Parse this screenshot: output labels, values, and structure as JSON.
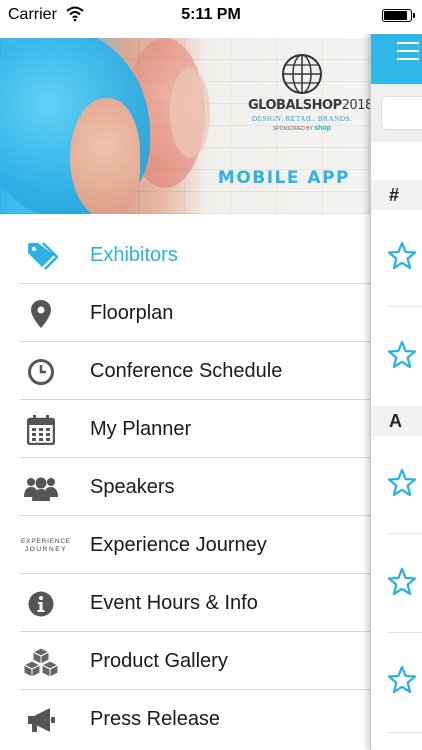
{
  "status_bar": {
    "carrier": "Carrier",
    "time": "5:11 PM"
  },
  "hero": {
    "brand_name": "GLOBALSHOP",
    "brand_year": "2018",
    "tagline": "DESIGN. RETAIL. BRANDS.",
    "sponsor_prefix": "SPONSORED BY",
    "sponsor_name": "shop",
    "subtitle": "MOBILE APP"
  },
  "menu": {
    "items": [
      {
        "label": "Exhibitors",
        "icon": "tags-icon",
        "active": true
      },
      {
        "label": "Floorplan",
        "icon": "map-marker-icon",
        "active": false
      },
      {
        "label": "Conference Schedule",
        "icon": "clock-icon",
        "active": false
      },
      {
        "label": "My Planner",
        "icon": "calendar-icon",
        "active": false
      },
      {
        "label": "Speakers",
        "icon": "users-icon",
        "active": false
      },
      {
        "label": "Experience Journey",
        "icon": "experience-journey-logo",
        "icon_text_top": "EXPERIENCE",
        "icon_text_bottom": "JOURNEY",
        "active": false
      },
      {
        "label": "Event Hours & Info",
        "icon": "info-circle-icon",
        "active": false
      },
      {
        "label": "Product Gallery",
        "icon": "cubes-icon",
        "active": false
      },
      {
        "label": "Press Release",
        "icon": "bullhorn-icon",
        "active": false
      }
    ]
  },
  "right_panel": {
    "section_headers": [
      "#",
      "A"
    ]
  },
  "colors": {
    "accent": "#2bb2e3",
    "header_blue": "#2fb7e8",
    "icon_gray": "#555555",
    "separator": "#d9d9d9"
  }
}
